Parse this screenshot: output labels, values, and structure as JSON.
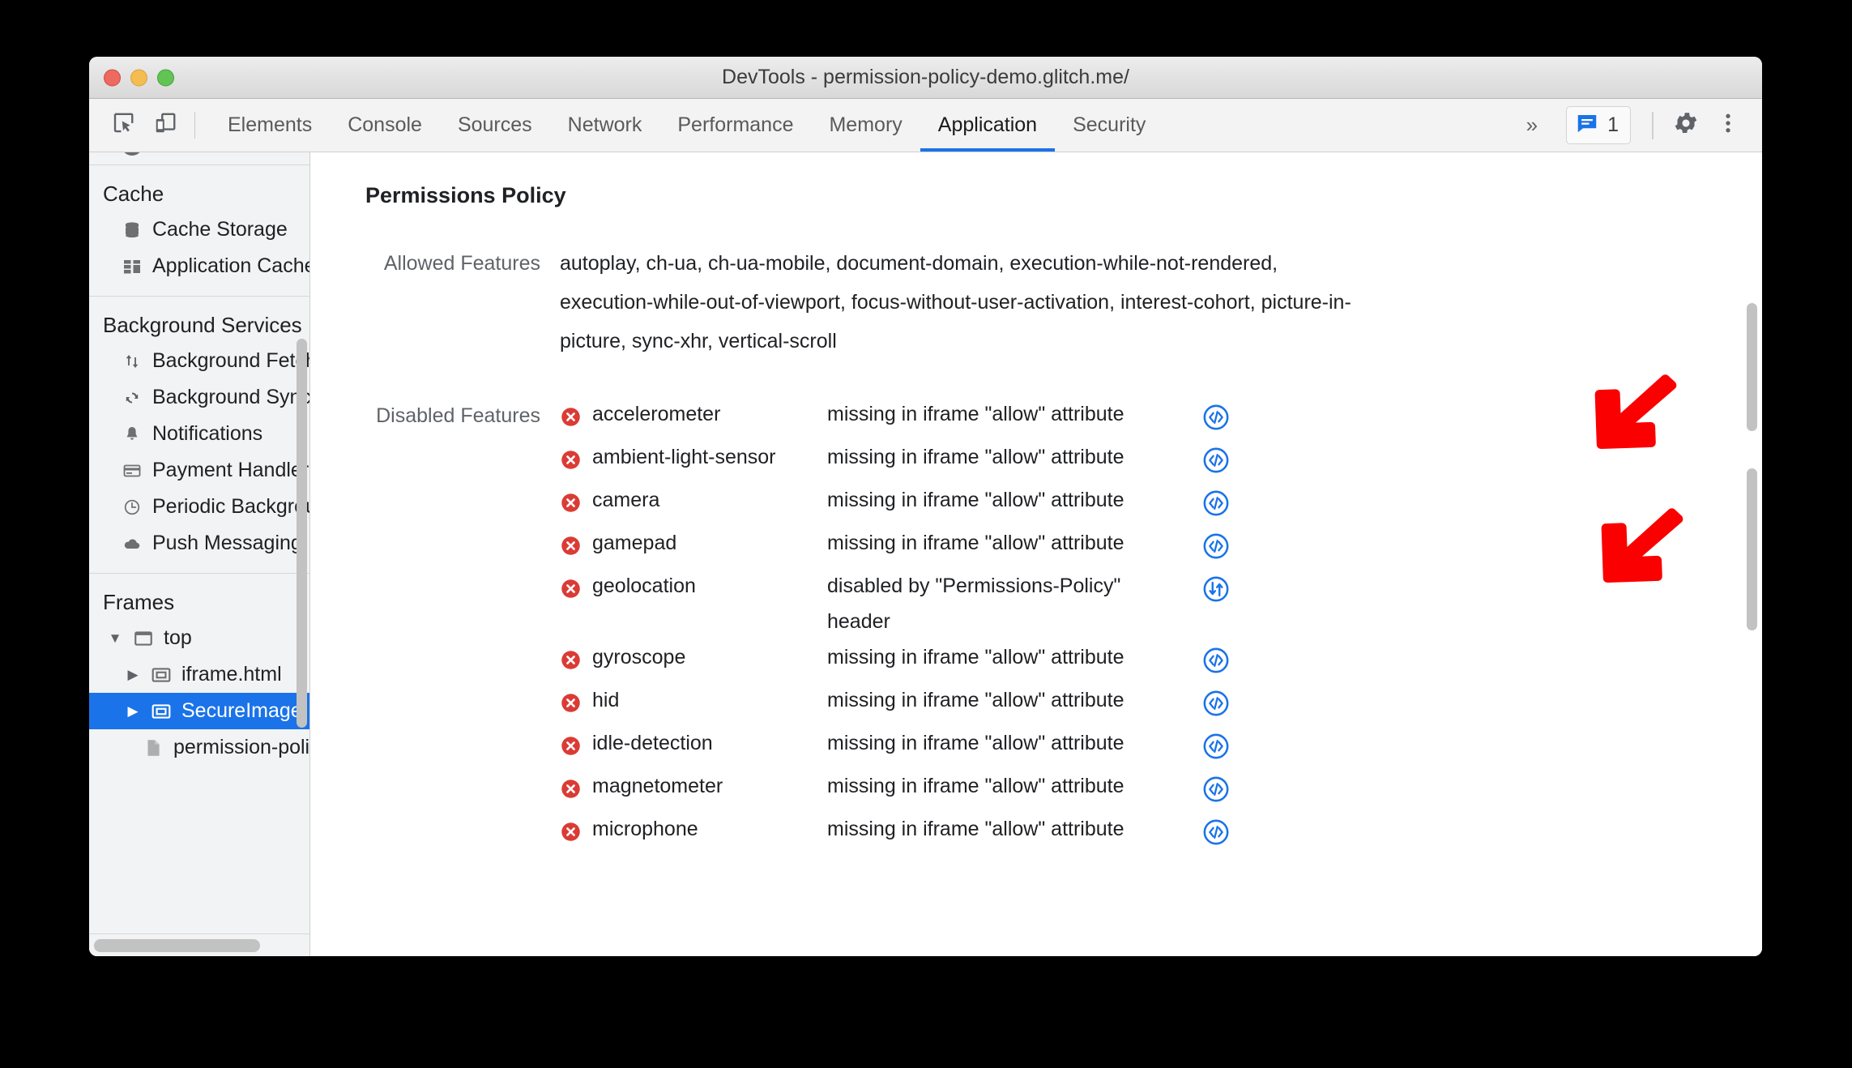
{
  "window": {
    "title": "DevTools - permission-policy-demo.glitch.me/",
    "traffic_lights": [
      "close-red",
      "minimize-yellow",
      "maximize-green"
    ]
  },
  "toolbar": {
    "inspect_icon": "inspect-element-icon",
    "device_icon": "device-toolbar-icon",
    "overflow_label": "»",
    "message_count": "1",
    "message_icon": "console-message-icon",
    "settings_icon": "gear-icon",
    "more_icon": "more-vertical-icon"
  },
  "tabs": [
    {
      "label": "Elements",
      "active": false
    },
    {
      "label": "Console",
      "active": false
    },
    {
      "label": "Sources",
      "active": false
    },
    {
      "label": "Network",
      "active": false
    },
    {
      "label": "Performance",
      "active": false
    },
    {
      "label": "Memory",
      "active": false
    },
    {
      "label": "Application",
      "active": true
    },
    {
      "label": "Security",
      "active": false
    }
  ],
  "sidebar": {
    "sections": [
      {
        "title": "Cache",
        "items": [
          {
            "label": "Cache Storage",
            "icon": "database-icon"
          },
          {
            "label": "Application Cache",
            "icon": "grid-icon"
          }
        ]
      },
      {
        "title": "Background Services",
        "items": [
          {
            "label": "Background Fetch",
            "icon": "updown-arrows-icon"
          },
          {
            "label": "Background Sync",
            "icon": "sync-icon"
          },
          {
            "label": "Notifications",
            "icon": "bell-icon"
          },
          {
            "label": "Payment Handler",
            "icon": "credit-card-icon"
          },
          {
            "label": "Periodic Backgroun",
            "icon": "clock-icon"
          },
          {
            "label": "Push Messaging",
            "icon": "cloud-icon"
          }
        ]
      },
      {
        "title": "Frames",
        "items": [
          {
            "label": "top",
            "icon": "frame-icon",
            "arrow": "▼",
            "indent": 1,
            "selected": false
          },
          {
            "label": "iframe.html",
            "icon": "subframe-icon",
            "arrow": "▶",
            "indent": 2,
            "selected": false
          },
          {
            "label": "SecureImage",
            "icon": "subframe-icon",
            "arrow": "▶",
            "indent": 2,
            "selected": true
          },
          {
            "label": "permission-policy",
            "icon": "document-icon",
            "arrow": "",
            "indent": 3,
            "selected": false
          }
        ]
      }
    ]
  },
  "main": {
    "heading": "Permissions Policy",
    "allowed_label": "Allowed Features",
    "allowed_features": "autoplay, ch-ua, ch-ua-mobile, document-domain, execution-while-not-rendered, execution-while-out-of-viewport, focus-without-user-activation, interest-cohort, picture-in-picture, sync-xhr, vertical-scroll",
    "disabled_label": "Disabled Features",
    "disabled_features": [
      {
        "name": "accelerometer",
        "reason": "missing in iframe \"allow\" attribute",
        "action_icon": "code-icon"
      },
      {
        "name": "ambient-light-sensor",
        "reason": "missing in iframe \"allow\" attribute",
        "action_icon": "code-icon"
      },
      {
        "name": "camera",
        "reason": "missing in iframe \"allow\" attribute",
        "action_icon": "code-icon"
      },
      {
        "name": "gamepad",
        "reason": "missing in iframe \"allow\" attribute",
        "action_icon": "code-icon"
      },
      {
        "name": "geolocation",
        "reason": "disabled by \"Permissions-Policy\" header",
        "action_icon": "network-request-icon"
      },
      {
        "name": "gyroscope",
        "reason": "missing in iframe \"allow\" attribute",
        "action_icon": "code-icon"
      },
      {
        "name": "hid",
        "reason": "missing in iframe \"allow\" attribute",
        "action_icon": "code-icon"
      },
      {
        "name": "idle-detection",
        "reason": "missing in iframe \"allow\" attribute",
        "action_icon": "code-icon"
      },
      {
        "name": "magnetometer",
        "reason": "missing in iframe \"allow\" attribute",
        "action_icon": "code-icon"
      },
      {
        "name": "microphone",
        "reason": "missing in iframe \"allow\" attribute",
        "action_icon": "code-icon"
      }
    ]
  },
  "annotations": [
    {
      "name": "red-arrow-annotation-top",
      "points": "down-left"
    },
    {
      "name": "red-arrow-annotation-bottom",
      "points": "down-left"
    }
  ],
  "colors": {
    "accent_blue": "#1a73e8",
    "error_red": "#db3b35",
    "annotation_red": "#fb0000",
    "sidebar_bg": "#f1f3f4",
    "titlebar_bg": "#e3e3e3"
  }
}
